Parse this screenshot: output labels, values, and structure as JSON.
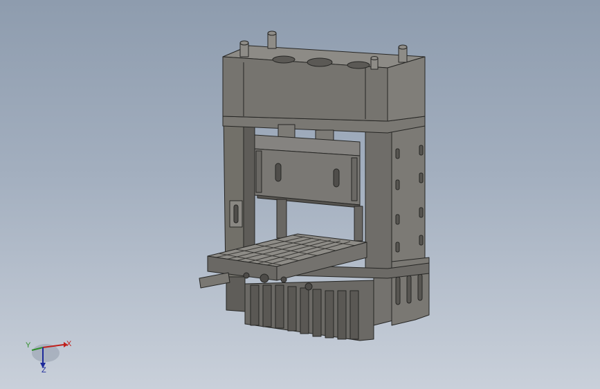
{
  "viewport": {
    "background_top": "#8e9cae",
    "background_bottom": "#c9d0da",
    "model_fill": "#6e6c68",
    "model_edge": "#2a2a28"
  },
  "triad": {
    "x_label": "X",
    "y_label": "Y",
    "z_label": "Z",
    "x_color": "#c0201c",
    "y_color": "#2f8f2a",
    "z_color": "#1d2a9a"
  }
}
